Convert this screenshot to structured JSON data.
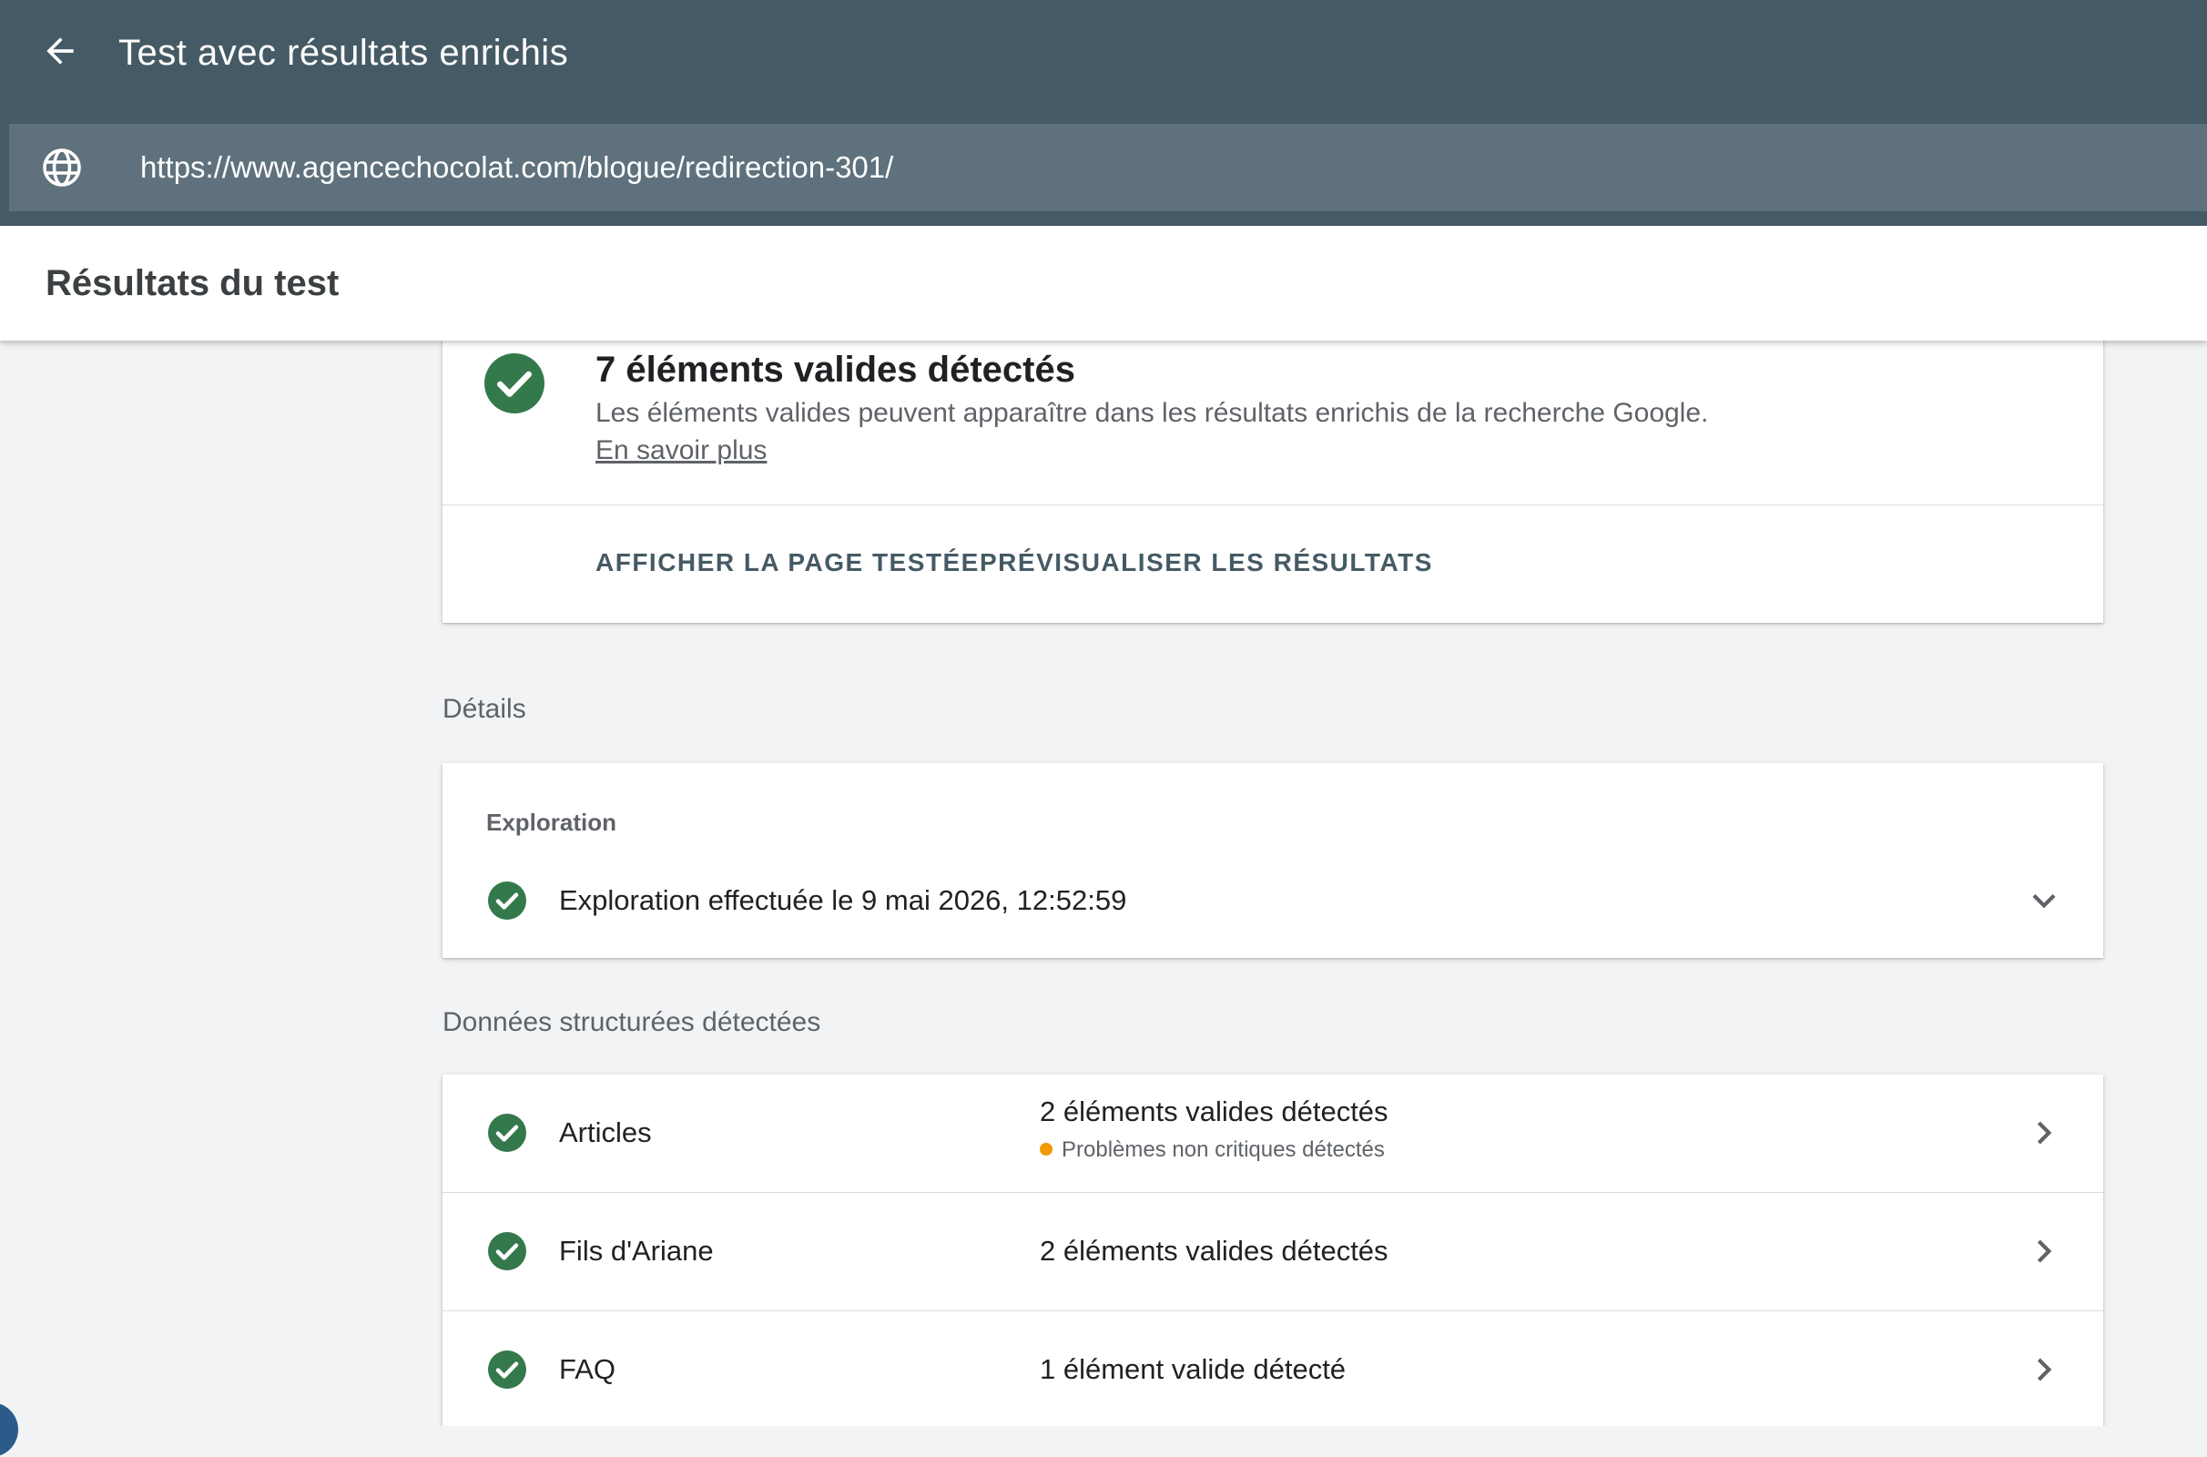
{
  "appbar": {
    "title": "Test avec résultats enrichis",
    "back_icon": "arrow-back-icon",
    "url": "https://www.agencechocolat.com/blogue/redirection-301/",
    "url_icon": "globe-icon",
    "background_color": "#455a64"
  },
  "results_header": {
    "title": "Résultats du test"
  },
  "summary": {
    "title": "7 éléments valides détectés",
    "description": "Les éléments valides peuvent apparaître dans les résultats enrichis de la recherche Google.",
    "link_text": "En savoir plus",
    "actions": [
      {
        "label": "AFFICHER LA PAGE TESTÉE"
      },
      {
        "label": "PRÉVISUALISER LES RÉSULTATS"
      }
    ],
    "status_color": "#34794b"
  },
  "details": {
    "section_label": "Détails",
    "exploration": {
      "heading": "Exploration",
      "text": "Exploration effectuée le 9 mai 2026, 12:52:59"
    }
  },
  "structured_data": {
    "section_label": "Données structurées détectées",
    "items": [
      {
        "name": "Articles",
        "status": "2 éléments valides détectés",
        "warning": "Problèmes non critiques détectés"
      },
      {
        "name": "Fils d'Ariane",
        "status": "2 éléments valides détectés"
      },
      {
        "name": "FAQ",
        "status": "1 élément valide détecté"
      }
    ],
    "warning_color": "#f29900"
  }
}
